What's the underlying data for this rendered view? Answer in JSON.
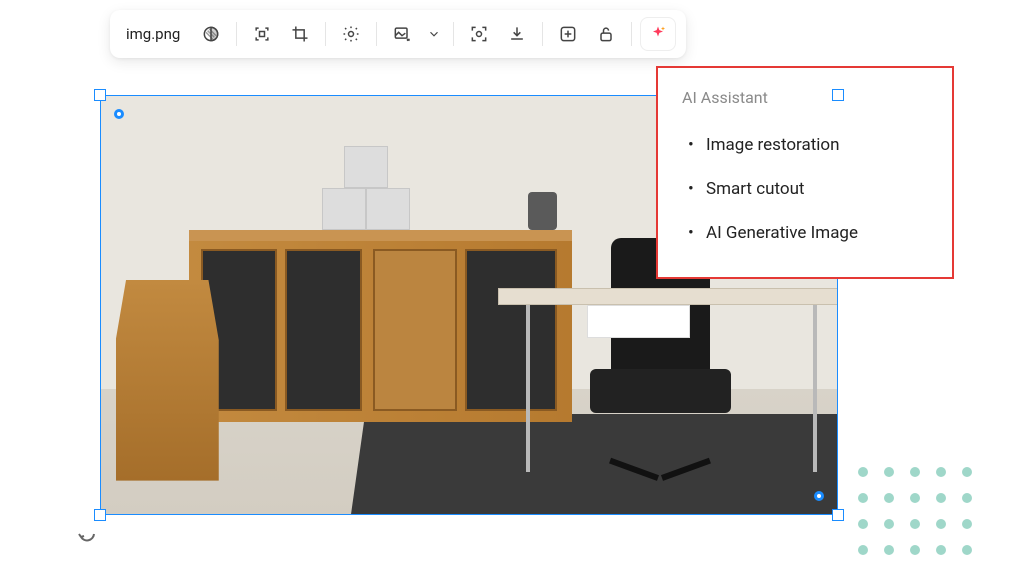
{
  "toolbar": {
    "filename": "img.png"
  },
  "popover": {
    "title": "AI Assistant",
    "items": [
      "Image restoration",
      "Smart cutout",
      "AI Generative Image"
    ]
  }
}
